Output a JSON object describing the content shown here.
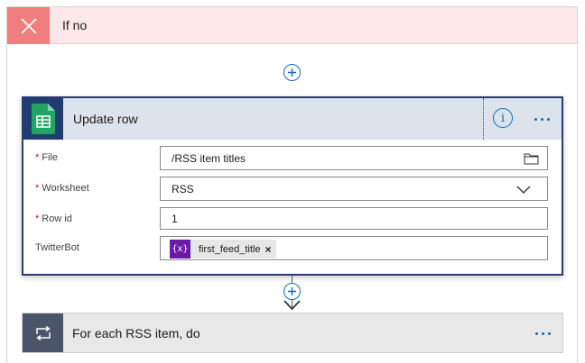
{
  "branch": {
    "title": "If no",
    "icon": "close-icon",
    "header_color": "#fde7e9",
    "icon_bg_color": "#f07e7e"
  },
  "action": {
    "title": "Update row",
    "icon": "google-sheets-icon",
    "info_icon": "info-icon",
    "more_icon": "more-options-icon",
    "fields": [
      {
        "label": "File",
        "required": true,
        "value": "/RSS item titles",
        "icon": "folder-icon"
      },
      {
        "label": "Worksheet",
        "required": true,
        "value": "RSS",
        "icon": "chevron-down-icon"
      },
      {
        "label": "Row id",
        "required": true,
        "value": "1"
      },
      {
        "label": "TwitterBot",
        "required": false,
        "token": {
          "icon_text": "{x}",
          "label": "first_feed_title",
          "remove": "×"
        }
      }
    ],
    "required_marker": "*",
    "accent_color": "#2a3c73"
  },
  "loop": {
    "title": "For each RSS item, do",
    "icon": "loop-icon",
    "more_icon": "more-options-icon"
  }
}
